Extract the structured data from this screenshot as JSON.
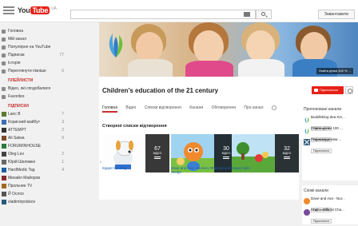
{
  "header": {
    "logo_you": "You",
    "logo_tube": "Tube",
    "logo_region": "UA",
    "search_placeholder": "",
    "upload_label": "Завантажити"
  },
  "guide": {
    "top": [
      {
        "label": "Головна",
        "icon": "home-icon"
      },
      {
        "label": "Мій канал",
        "icon": "user-icon"
      },
      {
        "label": "Популярне на YouTube",
        "icon": "fire-icon"
      },
      {
        "label": "Підписки",
        "icon": "subscriptions-icon",
        "count": "77"
      },
      {
        "label": "Історія",
        "icon": "history-icon"
      },
      {
        "label": "Переглянути пізніше",
        "icon": "clock-icon",
        "count": "6"
      }
    ],
    "playlists_title": "ПЛЕЙЛИСТИ",
    "playlists": [
      {
        "label": "Відео, які сподобалися",
        "icon": "thumbs-up-icon"
      },
      {
        "label": "Favorites",
        "icon": "list-icon"
      }
    ],
    "subs_title": "ПІДПИСКИ",
    "subs": [
      {
        "label": "Lanc B",
        "count": "7",
        "color": "#5a7d2a"
      },
      {
        "label": "Корисний майбут",
        "count": "3",
        "color": "#3b6db3"
      },
      {
        "label": "ATTEMPT",
        "count": "2",
        "color": "#333333"
      },
      {
        "label": "Ali Salwa",
        "count": "9",
        "color": "#7a4a2a"
      },
      {
        "label": "FORUMINHOUSE",
        "count": "",
        "color": "#2a7a3a"
      },
      {
        "label": "Oleg Lev",
        "count": "2",
        "color": "#444444"
      },
      {
        "label": "Юрій Шеляжко",
        "count": "1",
        "color": "#666666"
      },
      {
        "label": "HardMedic Tag",
        "count": "4",
        "color": "#1d5fa0"
      },
      {
        "label": "Михайл Майоров",
        "count": "",
        "color": "#8a2a2a"
      },
      {
        "label": "Прольчин TV",
        "count": "",
        "color": "#a06a1d"
      },
      {
        "label": "Й Ослоо",
        "count": "",
        "color": "#555555"
      },
      {
        "label": "vladimirpolskov",
        "count": "",
        "color": "#2a5a7a"
      }
    ]
  },
  "banner": {
    "caption": "Освіта дітям 100 % ..."
  },
  "channel": {
    "title": "Children's education of the 21 century",
    "subscribe_label": "Підписатися",
    "tabs": [
      "Головна",
      "Відео",
      "Списки відтворення",
      "Канали",
      "Обговорення",
      "Про канал"
    ]
  },
  "playlists_section": {
    "title": "Створені списки відтворення",
    "items": [
      {
        "title": "Kipper the Dog",
        "count": "67",
        "count_label": "ВІДЕО"
      },
      {
        "title": "Dave and Ava - Nursery Rhymes and Baby Songs",
        "count": "30",
        "count_label": "ВІДЕО"
      },
      {
        "title": "Magic balls",
        "count": "32",
        "count_label": "ВІДЕО"
      }
    ]
  },
  "recommended": {
    "title": "Пропоновані канали",
    "items": [
      {
        "name": "Buddleblog dea Kin...",
        "btn": "Підписатися"
      },
      {
        "name": "Освіта дітям 100 ...",
        "btn": "Підписатися"
      },
      {
        "name": "Перекладанням ...",
        "btn": "Підписатися"
      }
    ]
  },
  "similar": {
    "title": "Схожі канали",
    "items": [
      {
        "name": "Dave and Ava - Nur...",
        "btn": "Підписатися"
      },
      {
        "name": "Hunf -- Official Cha...",
        "btn": "Підписатися"
      }
    ]
  }
}
